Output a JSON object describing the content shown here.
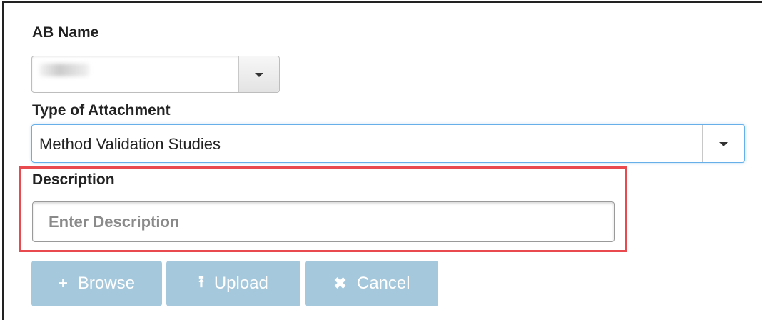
{
  "form": {
    "ab_name": {
      "label": "AB Name",
      "value_redacted": true,
      "dropdown_icon": "caret-down-icon"
    },
    "attachment_type": {
      "label": "Type of Attachment",
      "value": "Method Validation Studies",
      "dropdown_icon": "caret-down-icon"
    },
    "description": {
      "label": "Description",
      "placeholder": "Enter Description",
      "value": ""
    }
  },
  "buttons": {
    "browse": {
      "label": "Browse",
      "icon": "plus-icon",
      "glyph": "+"
    },
    "upload": {
      "label": "Upload",
      "icon": "upload-icon",
      "glyph": "⭱"
    },
    "cancel": {
      "label": "Cancel",
      "icon": "close-icon",
      "glyph": "✖"
    }
  },
  "colors": {
    "button_disabled_bg": "#a6c8dc",
    "highlight_border": "#e84a4f",
    "focus_border": "#66afe9"
  }
}
